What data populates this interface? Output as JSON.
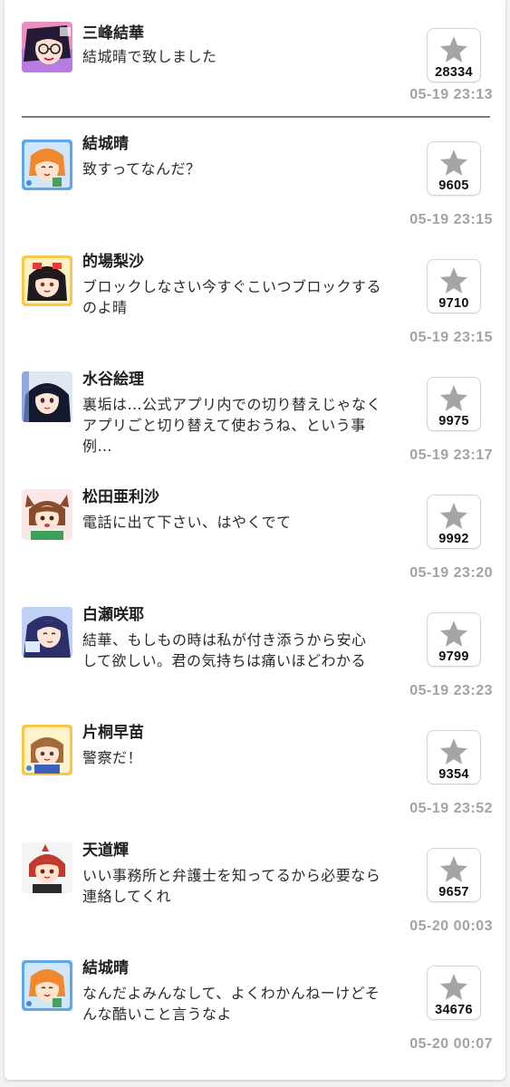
{
  "colors": {
    "star": "#a5a5a5",
    "timestamp": "#a3a3a3",
    "divider": "#7d7d7d"
  },
  "posts": [
    {
      "author": "三峰結華",
      "text": "結城晴で致しました",
      "likes": "28334",
      "time": "05-19 23:13",
      "avatar_icon": "mitsumine-yuika-avatar"
    },
    {
      "author": "結城晴",
      "text": "致すってなんだ？",
      "likes": "9605",
      "time": "05-19 23:15",
      "avatar_icon": "yuuki-haru-avatar"
    },
    {
      "author": "的場梨沙",
      "text": "ブロックしなさい今すぐこいつブロックするのよ晴",
      "likes": "9710",
      "time": "05-19 23:15",
      "avatar_icon": "matoba-risa-avatar"
    },
    {
      "author": "水谷絵理",
      "text": "裏垢は…公式アプリ内での切り替えじゃなくアプリごと切り替えて使おうね、という事例…",
      "likes": "9975",
      "time": "05-19 23:17",
      "avatar_icon": "mizutani-eri-avatar"
    },
    {
      "author": "松田亜利沙",
      "text": "電話に出て下さい、はやくでて",
      "likes": "9992",
      "time": "05-19 23:20",
      "avatar_icon": "matsuda-arisa-avatar"
    },
    {
      "author": "白瀬咲耶",
      "text": "結華、もしもの時は私が付き添うから安心して欲しい。君の気持ちは痛いほどわかる",
      "likes": "9799",
      "time": "05-19 23:23",
      "avatar_icon": "shirase-sakuya-avatar"
    },
    {
      "author": "片桐早苗",
      "text": "警察だ！",
      "likes": "9354",
      "time": "05-19 23:52",
      "avatar_icon": "katagiri-sanae-avatar"
    },
    {
      "author": "天道輝",
      "text": "いい事務所と弁護士を知ってるから必要なら連絡してくれ",
      "likes": "9657",
      "time": "05-20 00:03",
      "avatar_icon": "tendo-teru-avatar"
    },
    {
      "author": "結城晴",
      "text": "なんだよみんなして、よくわかんねーけどそんな酷いこと言うなよ",
      "likes": "34676",
      "time": "05-20 00:07",
      "avatar_icon": "yuuki-haru-avatar"
    }
  ]
}
